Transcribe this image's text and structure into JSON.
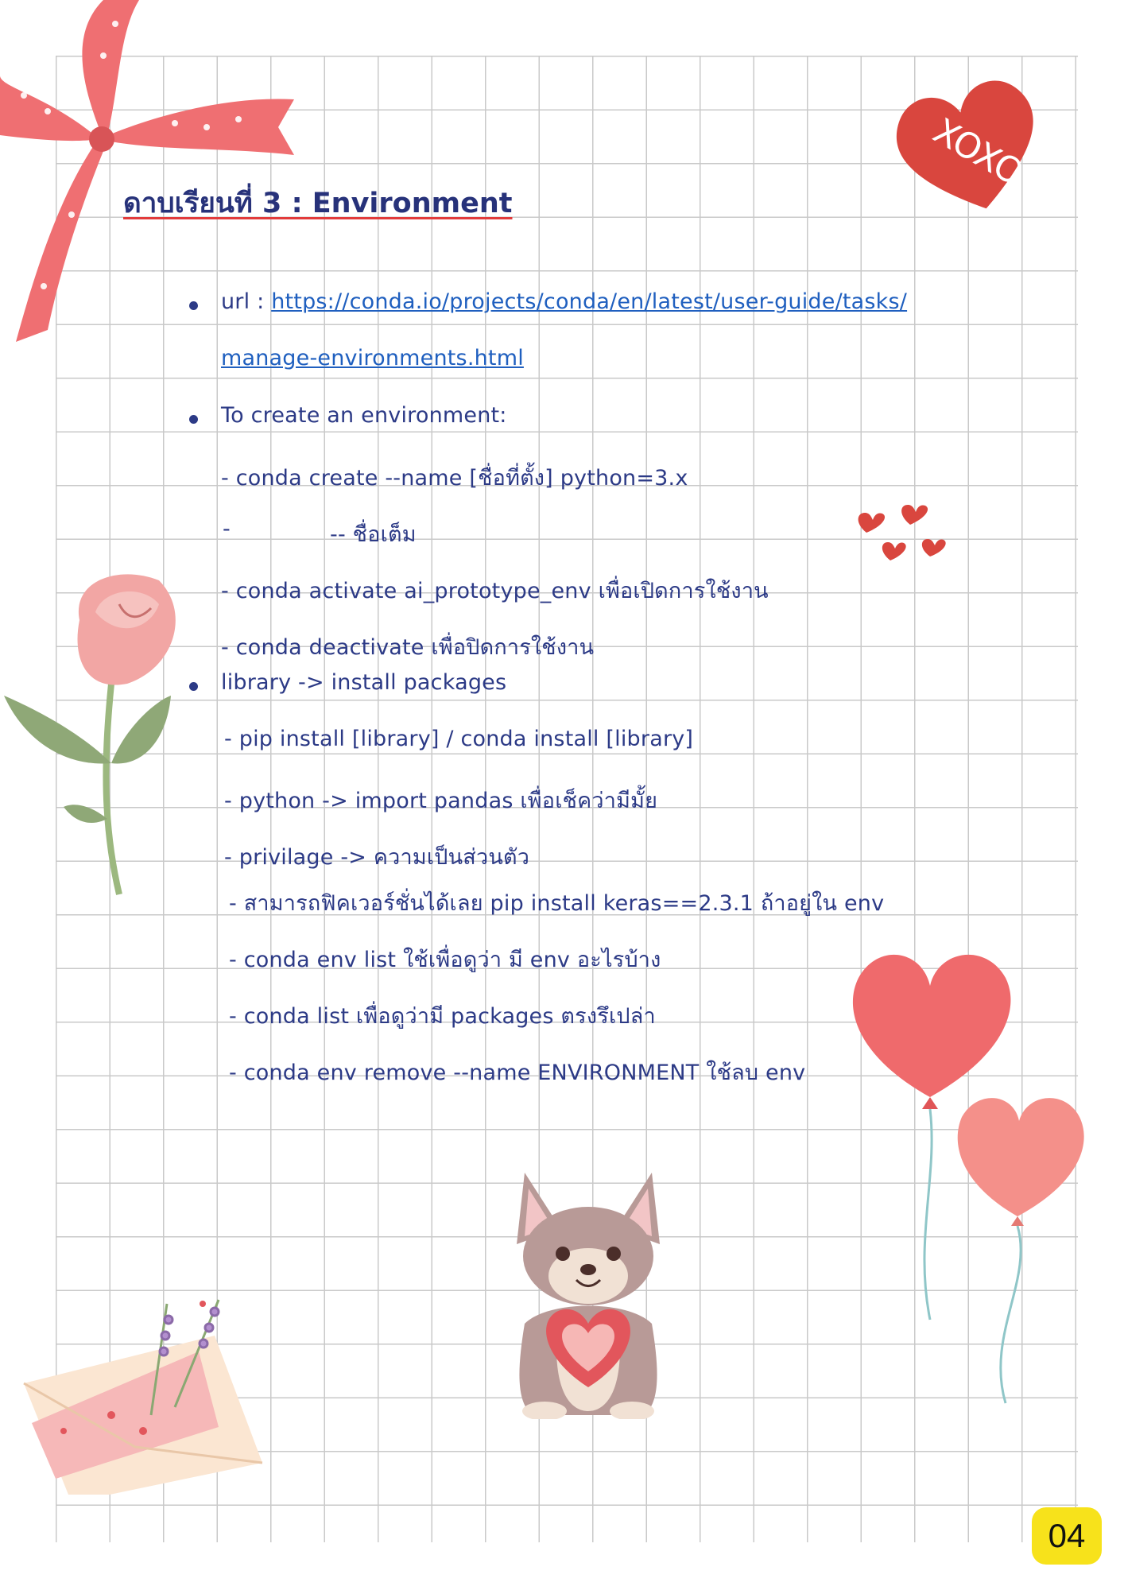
{
  "title": "ดาบเรียนที่ 3 : Environment",
  "bullets": {
    "url_label": "url : ",
    "url_line1": "https://conda.io/projects/conda/en/latest/user-guide/tasks/",
    "url_line2": "manage-environments.html",
    "create_heading": "To create an environment:",
    "create_cmd": "- conda create --name [ชื่อที่ตั้ง] python=3.x",
    "fullname_dash": "-",
    "fullname_text": "-- ชื่อเต็ม",
    "activate": "-  conda activate ai_prototype_env เพื่อเปิดการใช้งาน",
    "deactivate": "- conda deactivate เพื่อปิดการใช้งาน",
    "library_heading": "library -> install packages",
    "pip": "-   pip install [library] / conda install [library]",
    "python_import": "-   python -> import pandas เพื่อเช็คว่ามีมั้ย",
    "privilage": "-   privilage -> ความเป็นส่วนตัว",
    "fix_version": "-   สามารถฟิคเวอร์ชั่นได้เลย pip install keras==2.3.1 ถ้าอยู่ใน env",
    "env_list": "-   conda env list ใช้เพื่อดูว่า มี env อะไรบ้าง",
    "list": "-   conda list เพื่อดูว่ามี packages ตรงรึเปล่า",
    "remove": "-   conda env remove --name ENVIRONMENT ใช้ลบ env"
  },
  "decorations": {
    "xoxo_text": "XOXO"
  },
  "page_number": "04",
  "colors": {
    "text": "#2c3a86",
    "link": "#1f5fbf",
    "title_underline": "#e23b3b",
    "badge": "#f7e21b"
  }
}
